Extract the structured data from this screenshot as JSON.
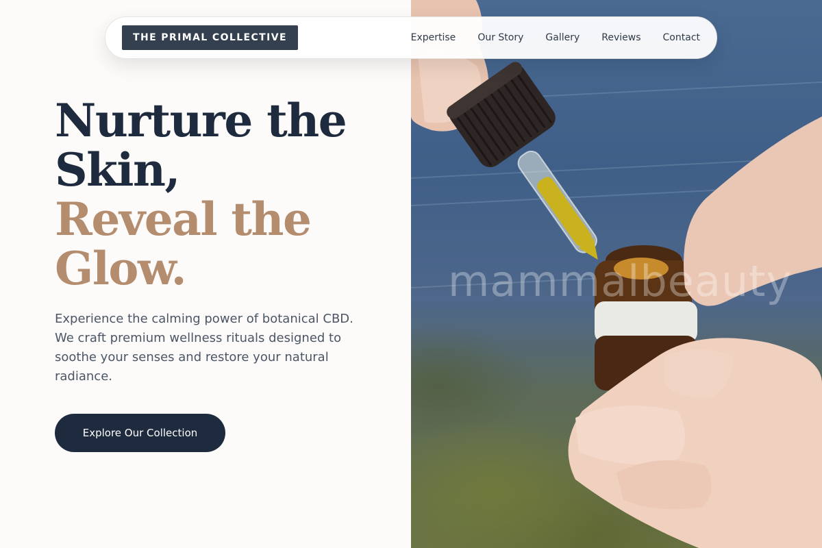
{
  "nav": {
    "brand": "THE PRIMAL COLLECTIVE",
    "links": [
      "Expertise",
      "Our Story",
      "Gallery",
      "Reviews",
      "Contact"
    ]
  },
  "hero": {
    "headline_line1": "Nurture the",
    "headline_line2": "Skin,",
    "headline_line3": "Reveal the",
    "headline_line4": "Glow.",
    "description": "Experience the calming power of botanical CBD. We craft premium wellness rituals designed to soothe your senses and restore your natural radiance.",
    "cta_label": "Explore Our Collection"
  },
  "image": {
    "watermark": "mammalbeauty",
    "subject": "hands-holding-cbd-oil-dropper-bottle"
  },
  "colors": {
    "navy": "#1e2a3e",
    "tan": "#b48c6e",
    "brand_bg": "#34404f",
    "page_bg": "#fdfbf9"
  }
}
